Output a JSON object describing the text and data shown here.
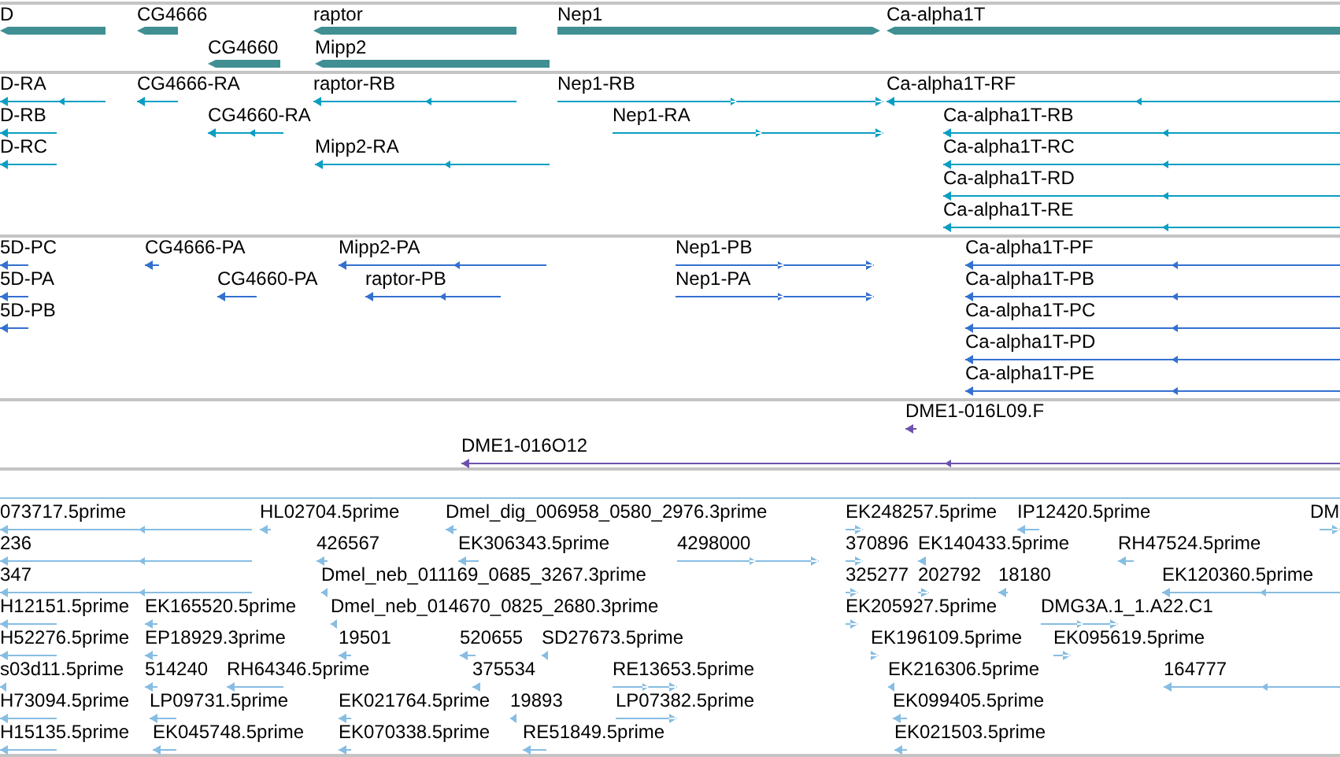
{
  "tracks": [
    {
      "kind": "gene",
      "features": [
        {
          "label": "D",
          "reverse_strand": true
        },
        {
          "label": "CG4666",
          "reverse_strand": true
        },
        {
          "label": "raptor",
          "reverse_strand": true
        },
        {
          "label": "Nep1",
          "reverse_strand": false
        },
        {
          "label": "Ca-alpha1T",
          "reverse_strand": true
        },
        {
          "label": "CG4660",
          "reverse_strand": true
        },
        {
          "label": "Mipp2",
          "reverse_strand": true
        }
      ]
    },
    {
      "kind": "transcript",
      "features": [
        {
          "label": "D-RA",
          "reverse_strand": true
        },
        {
          "label": "CG4666-RA",
          "reverse_strand": true
        },
        {
          "label": "raptor-RB",
          "reverse_strand": true
        },
        {
          "label": "Nep1-RB",
          "reverse_strand": false
        },
        {
          "label": "Ca-alpha1T-RF",
          "reverse_strand": true
        },
        {
          "label": "D-RB",
          "reverse_strand": true
        },
        {
          "label": "CG4660-RA",
          "reverse_strand": true
        },
        {
          "label": "Nep1-RA",
          "reverse_strand": false
        },
        {
          "label": "Ca-alpha1T-RB",
          "reverse_strand": true
        },
        {
          "label": "D-RC",
          "reverse_strand": true
        },
        {
          "label": "Mipp2-RA",
          "reverse_strand": true
        },
        {
          "label": "Ca-alpha1T-RC",
          "reverse_strand": true
        },
        {
          "label": "Ca-alpha1T-RD",
          "reverse_strand": true
        },
        {
          "label": "Ca-alpha1T-RE",
          "reverse_strand": true
        }
      ]
    },
    {
      "kind": "protein",
      "features": [
        {
          "label": "5D-PC",
          "reverse_strand": true
        },
        {
          "label": "CG4666-PA",
          "reverse_strand": true
        },
        {
          "label": "Mipp2-PA",
          "reverse_strand": true
        },
        {
          "label": "Nep1-PB",
          "reverse_strand": false
        },
        {
          "label": "Ca-alpha1T-PF",
          "reverse_strand": true
        },
        {
          "label": "5D-PA",
          "reverse_strand": true
        },
        {
          "label": "CG4660-PA",
          "reverse_strand": true
        },
        {
          "label": "raptor-PB",
          "reverse_strand": true
        },
        {
          "label": "Nep1-PA",
          "reverse_strand": false
        },
        {
          "label": "Ca-alpha1T-PB",
          "reverse_strand": true
        },
        {
          "label": "5D-PB",
          "reverse_strand": true
        },
        {
          "label": "Ca-alpha1T-PC",
          "reverse_strand": true
        },
        {
          "label": "Ca-alpha1T-PD",
          "reverse_strand": true
        },
        {
          "label": "Ca-alpha1T-PE",
          "reverse_strand": true
        }
      ]
    },
    {
      "kind": "clone",
      "features": [
        {
          "label": "DME1-016L09.F",
          "reverse_strand": true
        },
        {
          "label": "DME1-016O12",
          "reverse_strand": true
        }
      ]
    },
    {
      "kind": "est",
      "features": [
        {
          "label": "073717.5prime",
          "reverse_strand": true
        },
        {
          "label": "HL02704.5prime",
          "reverse_strand": true
        },
        {
          "label": "Dmel_dig_006958_0580_2976.3prime",
          "reverse_strand": true
        },
        {
          "label": "EK248257.5prime",
          "reverse_strand": false
        },
        {
          "label": "IP12420.5prime",
          "reverse_strand": true
        },
        {
          "label": "DM",
          "reverse_strand": false
        },
        {
          "label": "236",
          "reverse_strand": true
        },
        {
          "label": "426567",
          "reverse_strand": true
        },
        {
          "label": "EK306343.5prime",
          "reverse_strand": true
        },
        {
          "label": "4298000",
          "reverse_strand": false
        },
        {
          "label": "370896",
          "reverse_strand": false
        },
        {
          "label": "EK140433.5prime",
          "reverse_strand": true
        },
        {
          "label": "RH47524.5prime",
          "reverse_strand": true
        },
        {
          "label": "347",
          "reverse_strand": true
        },
        {
          "label": "Dmel_neb_011169_0685_3267.3prime",
          "reverse_strand": true
        },
        {
          "label": "325277",
          "reverse_strand": false
        },
        {
          "label": "202792",
          "reverse_strand": false
        },
        {
          "label": "18180",
          "reverse_strand": true
        },
        {
          "label": "EK120360.5prime",
          "reverse_strand": true
        },
        {
          "label": "H12151.5prime",
          "reverse_strand": true
        },
        {
          "label": "EK165520.5prime",
          "reverse_strand": true
        },
        {
          "label": "Dmel_neb_014670_0825_2680.3prime",
          "reverse_strand": true
        },
        {
          "label": "EK205927.5prime",
          "reverse_strand": false
        },
        {
          "label": "DMG3A.1_1.A22.C1",
          "reverse_strand": false
        },
        {
          "label": "H52276.5prime",
          "reverse_strand": true
        },
        {
          "label": "EP18929.3prime",
          "reverse_strand": true
        },
        {
          "label": "19501",
          "reverse_strand": true
        },
        {
          "label": "520655",
          "reverse_strand": true
        },
        {
          "label": "SD27673.5prime",
          "reverse_strand": true
        },
        {
          "label": "EK196109.5prime",
          "reverse_strand": false
        },
        {
          "label": "EK095619.5prime",
          "reverse_strand": false
        },
        {
          "label": "s03d11.5prime",
          "reverse_strand": true
        },
        {
          "label": "514240",
          "reverse_strand": true
        },
        {
          "label": "RH64346.5prime",
          "reverse_strand": true
        },
        {
          "label": "375534",
          "reverse_strand": true
        },
        {
          "label": "RE13653.5prime",
          "reverse_strand": false
        },
        {
          "label": "EK216306.5prime",
          "reverse_strand": true
        },
        {
          "label": "164777",
          "reverse_strand": true
        },
        {
          "label": "H73094.5prime",
          "reverse_strand": true
        },
        {
          "label": "LP09731.5prime",
          "reverse_strand": true
        },
        {
          "label": "EK021764.5prime",
          "reverse_strand": true
        },
        {
          "label": "19893",
          "reverse_strand": true
        },
        {
          "label": "LP07382.5prime",
          "reverse_strand": false
        },
        {
          "label": "EK099405.5prime",
          "reverse_strand": true
        },
        {
          "label": "H15135.5prime",
          "reverse_strand": true
        },
        {
          "label": "EK045748.5prime",
          "reverse_strand": true
        },
        {
          "label": "EK070338.5prime",
          "reverse_strand": true
        },
        {
          "label": "RE51849.5prime",
          "reverse_strand": true
        },
        {
          "label": "EK021503.5prime",
          "reverse_strand": true
        }
      ]
    }
  ]
}
